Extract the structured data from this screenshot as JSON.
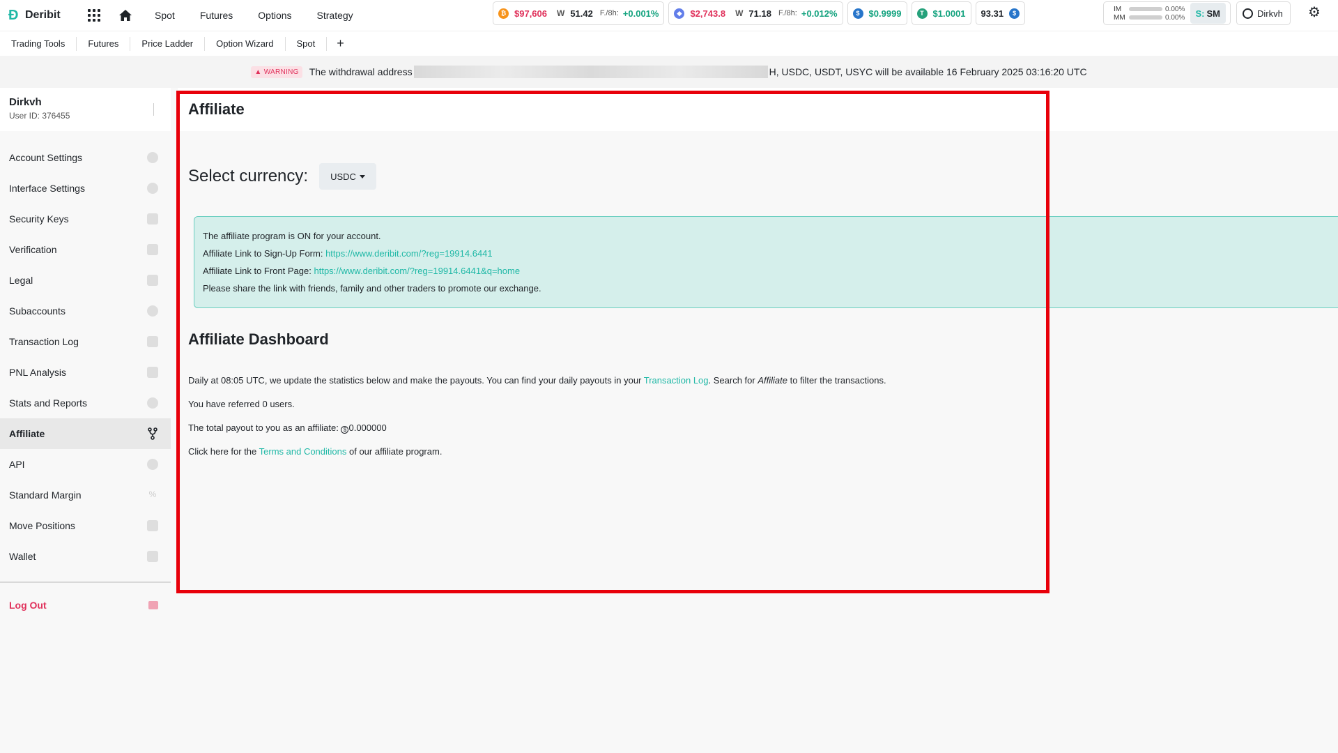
{
  "app": {
    "name": "Deribit"
  },
  "nav": [
    "Spot",
    "Futures",
    "Options",
    "Strategy"
  ],
  "tickers": [
    {
      "price": "$97,606",
      "volatility": "51.42",
      "funding_label": "F./8h:",
      "funding": "+0.001%"
    },
    {
      "price": "$2,743.8",
      "volatility": "71.18",
      "funding_label": "F./8h:",
      "funding": "+0.012%"
    },
    {
      "price": "$0.9999"
    },
    {
      "price": "$1.0001"
    },
    {
      "price": "93.31"
    }
  ],
  "margin": {
    "im_label": "IM",
    "im_value": "0.00%",
    "mm_label": "MM",
    "mm_value": "0.00%",
    "mode_prefix": "S:",
    "mode": "SM"
  },
  "user": {
    "name": "Dirkvh",
    "id_text": "User ID: 376455"
  },
  "tools": [
    "Trading Tools",
    "Futures",
    "Price Ladder",
    "Option Wizard",
    "Spot"
  ],
  "warning": {
    "badge": "WARNING",
    "text_before": "The withdrawal address",
    "text_after": "H, USDC, USDT, USYC will be available 16 February 2025 03:16:20 UTC"
  },
  "sidebar": {
    "items": [
      {
        "label": "Account Settings",
        "icon": "user-icon"
      },
      {
        "label": "Interface Settings",
        "icon": "gear-icon"
      },
      {
        "label": "Security Keys",
        "icon": "lock-icon"
      },
      {
        "label": "Verification",
        "icon": "document-icon"
      },
      {
        "label": "Legal",
        "icon": "gavel-icon"
      },
      {
        "label": "Subaccounts",
        "icon": "user-plus-icon"
      },
      {
        "label": "Transaction Log",
        "icon": "file-icon"
      },
      {
        "label": "PNL Analysis",
        "icon": "file-icon"
      },
      {
        "label": "Stats and Reports",
        "icon": "pie-chart-icon"
      },
      {
        "label": "Affiliate",
        "icon": "branch-icon"
      },
      {
        "label": "API",
        "icon": "cloud-icon"
      },
      {
        "label": "Standard Margin",
        "icon": "percent-icon"
      },
      {
        "label": "Move Positions",
        "icon": "copy-icon"
      },
      {
        "label": "Wallet",
        "icon": "wallet-icon"
      }
    ],
    "logout": "Log Out"
  },
  "page": {
    "title": "Affiliate",
    "currency_label": "Select currency:",
    "currency_value": "USDC",
    "info": {
      "line1": "The affiliate program is ON for your account.",
      "signup_label": "Affiliate Link to Sign-Up Form:",
      "signup_link": "https://www.deribit.com/?reg=19914.6441",
      "front_label": "Affiliate Link to Front Page:",
      "front_link": "https://www.deribit.com/?reg=19914.6441&q=home",
      "line4": "Please share the link with friends, family and other traders to promote our exchange."
    },
    "dashboard": {
      "title": "Affiliate Dashboard",
      "p1_before": "Daily at 08:05 UTC, we update the statistics below and make the payouts. You can find your daily payouts in your ",
      "p1_link": "Transaction Log",
      "p1_mid": ". Search for ",
      "p1_em": "Affiliate",
      "p1_after": " to filter the transactions.",
      "p2": "You have referred 0 users.",
      "p3_label": "The total payout to you as an affiliate:",
      "p3_value": "0.000000",
      "p4_before": "Click here for the ",
      "p4_link": "Terms and Conditions",
      "p4_after": " of our affiliate program."
    }
  },
  "colors": {
    "accent": "#1fb8a6",
    "negative": "#e0315b",
    "positive": "#14a37f",
    "highlight": "#e8000a"
  }
}
